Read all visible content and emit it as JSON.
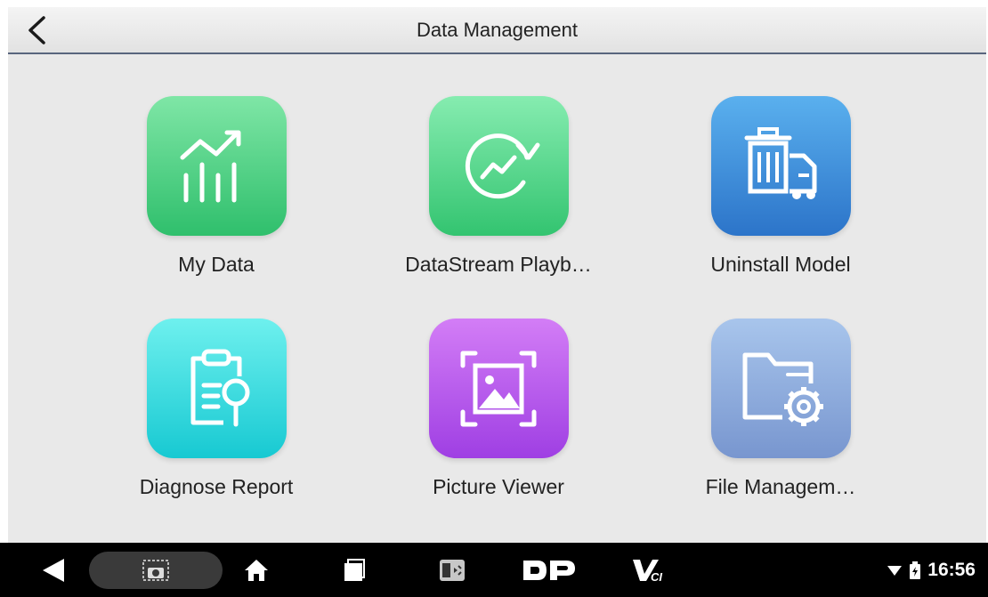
{
  "header": {
    "title": "Data Management",
    "back_icon": "chevron-left-icon"
  },
  "tiles": [
    {
      "label": "My Data",
      "icon": "chart-trend-icon",
      "colors": [
        "#7fe6a6",
        "#2fbf6c"
      ]
    },
    {
      "label": "DataStream Playb…",
      "icon": "refresh-trend-icon",
      "colors": [
        "#86ecb0",
        "#33c470"
      ]
    },
    {
      "label": "Uninstall Model",
      "icon": "trash-car-icon",
      "colors": [
        "#5ab0ee",
        "#2c74c9"
      ]
    },
    {
      "label": "Diagnose Report",
      "icon": "clipboard-search-icon",
      "colors": [
        "#6ef0ee",
        "#17c9d2"
      ]
    },
    {
      "label": "Picture Viewer",
      "icon": "image-icon",
      "colors": [
        "#d37df6",
        "#9f3fe3"
      ]
    },
    {
      "label": "File Managem…",
      "icon": "folder-gear-icon",
      "colors": [
        "#a8c5ec",
        "#7896cf"
      ]
    }
  ],
  "navbar": {
    "items": [
      "back-icon",
      "screenshot-icon",
      "home-icon",
      "recents-icon",
      "multi-screen-icon",
      "dp-logo",
      "vci-logo"
    ],
    "dp_text": "DP",
    "vci_text": "VCI",
    "clock": "16:56",
    "status_icons": [
      "wifi-icon",
      "battery-icon"
    ]
  },
  "colors": {
    "title_underline": "#59657d",
    "background": "#e9e9e9",
    "navbar": "#000000"
  }
}
